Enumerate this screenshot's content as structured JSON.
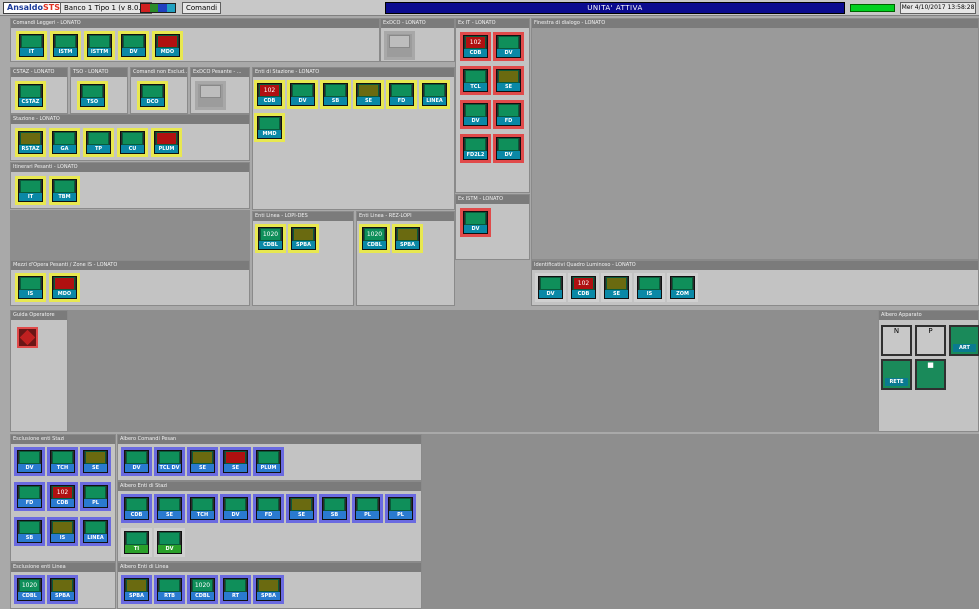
{
  "topbar": {
    "brand_a": "Ansaldo",
    "brand_b": "STS",
    "session": "Banco 1 Tipo 1 (v 8.0.3)",
    "cmd_button": "Comandi",
    "status": "UNITA' ATTIVA",
    "datetime": "Mer 4/10/2017  13:58:28",
    "strip_colors": [
      "#d02020",
      "#2a8a2a",
      "#2040c0",
      "#20a0c0"
    ]
  },
  "panels": {
    "comandi_leggeri": {
      "title": "Comandi Leggeri - LONATO",
      "buttons": [
        "IT",
        "ISTM",
        "ISTTM",
        "DV",
        "MDO"
      ]
    },
    "exdco": {
      "title": "ExDCO - LONATO"
    },
    "cstaz": {
      "title": "CSTAZ - LONATO",
      "buttons": [
        "CSTAZ"
      ]
    },
    "tso": {
      "title": "TSO - LONATO",
      "buttons": [
        "TSO"
      ]
    },
    "comandi_esclusione": {
      "title": "Comandi non Esclud...",
      "buttons": [
        "DCO"
      ]
    },
    "exdco_pesante": {
      "title": "ExDCO Pesante - ..."
    },
    "enti_stazione": {
      "title": "Enti di Stazione - LONATO",
      "buttons": [
        "CDB",
        "DV",
        "SB",
        "SE",
        "FD",
        "LINEA",
        "MMD"
      ]
    },
    "ex_it": {
      "title": "Ex IT - LONATO",
      "buttons": [
        "CDB",
        "DV",
        "TCL",
        "SE",
        "DV",
        "FD",
        "FD2L2",
        "DV"
      ]
    },
    "finestra": {
      "title": "Finestra di dialogo - LONATO"
    },
    "stazione": {
      "title": "Stazione - LONATO",
      "buttons": [
        "RSTAZ",
        "GA",
        "TP",
        "CU",
        "PLUM"
      ]
    },
    "itinerari_pesanti": {
      "title": "Itinerari Pesanti - LONATO",
      "buttons": [
        "IT",
        "TBM"
      ]
    },
    "ex_istm": {
      "title": "Ex ISTM - LONATO",
      "buttons": [
        "DV"
      ]
    },
    "enti_linea_lop": {
      "title": "Enti Linea - LOPI-DES",
      "buttons": [
        "CDBL",
        "SPBA"
      ]
    },
    "enti_linea_rez": {
      "title": "Enti Linea - REZ-LOPI",
      "buttons": [
        "CDBL",
        "SPBA"
      ]
    },
    "mezzi_opera": {
      "title": "Mezzi d'Opera Pesanti / Zone IS - LONATO",
      "buttons": [
        "IS",
        "MDO"
      ]
    },
    "identificativi": {
      "title": "Identificativi Quadro Luminoso - LONATO",
      "buttons": [
        "DV",
        "CDB",
        "SE",
        "IS",
        "ZOM"
      ]
    },
    "guida": {
      "title": "Guida Operatore"
    },
    "albero_apparato": {
      "title": "Albero Apparato",
      "buttons": [
        "ART",
        "RETE"
      ]
    },
    "esclusione_enti_stazi": {
      "title": "Esclusione enti Stazi",
      "buttons": [
        "DV",
        "TCH",
        "SE",
        "FD",
        "CDB",
        "PL",
        "SB",
        "IS",
        "LINEA"
      ]
    },
    "albero_comandi": {
      "title": "Albero Comandi Pesan",
      "buttons": [
        "DV",
        "TCL DV",
        "SE",
        "SE",
        "PLUM"
      ]
    },
    "albero_enti_stazi": {
      "title": "Albero Enti di Stazi",
      "buttons": [
        "CDB",
        "SE",
        "TCH",
        "DV",
        "FD",
        "SE",
        "SB",
        "PL",
        "PL",
        "TI",
        "DV"
      ]
    },
    "esclusione_linea": {
      "title": "Esclusione enti Linea",
      "buttons": [
        "CDBL",
        "SPBA"
      ]
    },
    "albero_linea": {
      "title": "Albero Enti di Linea",
      "buttons": [
        "SPBA",
        "RTB",
        "CDBL",
        "RT",
        "SPBA"
      ]
    }
  },
  "icons": {
    "icon_text_102": "102",
    "icon_text_1020": "1020",
    "icon_n": "N",
    "icon_p": "P"
  }
}
